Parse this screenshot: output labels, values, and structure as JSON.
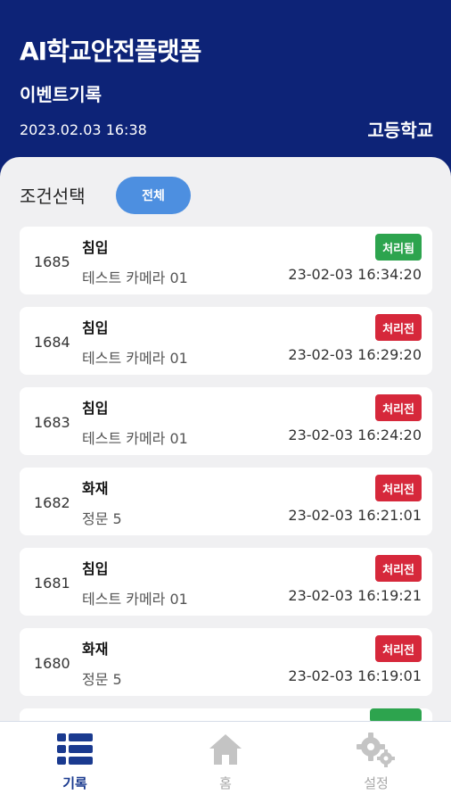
{
  "header": {
    "app_title": "AI학교안전플랫폼",
    "subtitle": "이벤트기록",
    "datetime": "2023.02.03 16:38",
    "school": "고등학교"
  },
  "filter": {
    "label": "조건선택",
    "button": "전체"
  },
  "events": [
    {
      "id": "1685",
      "type": "침입",
      "camera": "테스트 카메라 01",
      "time": "23-02-03 16:34:20",
      "status": "처리됨",
      "status_color": "#2da44e"
    },
    {
      "id": "1684",
      "type": "침입",
      "camera": "테스트 카메라 01",
      "time": "23-02-03 16:29:20",
      "status": "처리전",
      "status_color": "#d6283b"
    },
    {
      "id": "1683",
      "type": "침입",
      "camera": "테스트 카메라 01",
      "time": "23-02-03 16:24:20",
      "status": "처리전",
      "status_color": "#d6283b"
    },
    {
      "id": "1682",
      "type": "화재",
      "camera": "정문 5",
      "time": "23-02-03 16:21:01",
      "status": "처리전",
      "status_color": "#d6283b"
    },
    {
      "id": "1681",
      "type": "침입",
      "camera": "테스트 카메라 01",
      "time": "23-02-03 16:19:21",
      "status": "처리전",
      "status_color": "#d6283b"
    },
    {
      "id": "1680",
      "type": "화재",
      "camera": "정문 5",
      "time": "23-02-03 16:19:01",
      "status": "처리전",
      "status_color": "#d6283b"
    }
  ],
  "tabs": [
    {
      "label": "기록",
      "icon": "list-icon",
      "active": true
    },
    {
      "label": "홈",
      "icon": "home-icon",
      "active": false
    },
    {
      "label": "설정",
      "icon": "gear-icon",
      "active": false
    }
  ],
  "colors": {
    "header_bg": "#0d2377",
    "accent": "#4d8fe0",
    "done": "#2da44e",
    "pending": "#d6283b"
  }
}
